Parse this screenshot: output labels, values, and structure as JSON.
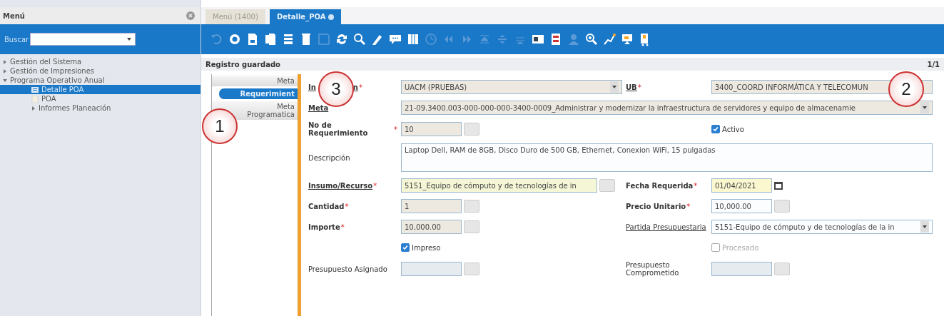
{
  "sidebar": {
    "title": "Menú",
    "search": {
      "label": "Buscar"
    },
    "tree": [
      {
        "label": "Gestión del Sistema",
        "expanded": false,
        "selected": false
      },
      {
        "label": "Gestión de Impresiones",
        "expanded": false,
        "selected": false
      },
      {
        "label": "Programa Operativo Anual",
        "expanded": true,
        "selected": false,
        "children": [
          {
            "label": "Detalle POA",
            "kind": "form",
            "selected": true
          },
          {
            "label": "POA",
            "kind": "doc",
            "selected": false
          },
          {
            "label": "Informes Planeación",
            "kind": "folder",
            "selected": false
          }
        ]
      }
    ]
  },
  "tabs": [
    {
      "label": "Menú (1400)",
      "selected": false,
      "closable": false
    },
    {
      "label": "Detalle_POA",
      "selected": true,
      "closable": true
    }
  ],
  "toolbar": [
    {
      "disabled": true
    },
    {
      "disabled": false
    },
    {
      "disabled": false
    },
    {
      "disabled": false
    },
    {
      "disabled": false
    },
    {
      "disabled": false
    },
    {
      "disabled": true
    },
    {
      "disabled": false
    },
    {
      "disabled": false
    },
    {
      "disabled": false
    },
    {
      "disabled": false
    },
    {
      "disabled": false
    },
    {
      "disabled": true
    },
    {
      "disabled": true
    },
    {
      "disabled": true
    },
    {
      "disabled": true
    },
    {
      "disabled": true
    },
    {
      "disabled": true
    },
    {
      "disabled": false
    },
    {
      "disabled": false
    },
    {
      "disabled": true
    },
    {
      "disabled": false
    },
    {
      "disabled": false
    },
    {
      "disabled": false
    },
    {
      "disabled": false
    }
  ],
  "status": {
    "message": "Registro guardado",
    "record": "1/1"
  },
  "side_tabs": [
    {
      "lines": [
        "Meta"
      ],
      "selected": false
    },
    {
      "lines": [
        "Requerimient"
      ],
      "selected": true
    },
    {
      "lines": [
        "Meta",
        "Programatica"
      ],
      "selected": false
    }
  ],
  "form": {
    "rows": [
      [
        {
          "kind": "select",
          "label": "In",
          "label_end": "n",
          "asterisk": "*",
          "link": true,
          "bold": true,
          "value": "UACM (PRUEBAS)",
          "color": "#ede9e0"
        },
        {
          "kind": "text",
          "label": "UB",
          "asterisk": "*",
          "link": true,
          "bold": true,
          "value": "3400_COORD INFORMÁTICA Y TELECOMUN",
          "color": "#ede9e0"
        }
      ],
      [
        {
          "kind": "select",
          "label": "Meta",
          "link": true,
          "bold": true,
          "value": "21-09.3400.003-000-000-000-3400-0009_Administrar y modernizar la infraestructura de servidores y equipo de almacenamie",
          "color": "#ede9e0",
          "wide": true
        }
      ],
      [
        {
          "kind": "lookup",
          "label": "No de Requerimiento",
          "asterisk": "*",
          "link": false,
          "bold": true,
          "value": "10",
          "color": "#ede9e0"
        },
        {
          "kind": "checkbox",
          "text": "Activo",
          "checked": true,
          "disabled": false
        }
      ],
      [
        {
          "kind": "textarea",
          "label": "Descripción",
          "link": false,
          "bold": false,
          "value": "Laptop Dell, RAM de 8GB, Disco Duro de 500 GB, Ethernet, Conexion WiFi, 15 pulgadas",
          "color": "#fbfdff",
          "wide": true
        }
      ],
      [
        {
          "kind": "lookup",
          "label": "Insumo/Recurso",
          "asterisk": "*",
          "link": true,
          "bold": true,
          "value": "5151_Equipo de cómputo y de tecnologías de in",
          "color": "#f4f6d6",
          "wide": false
        },
        {
          "kind": "date",
          "label": "Fecha Requerida",
          "asterisk": "*",
          "link": false,
          "bold": true,
          "value": "01/04/2021",
          "color": "#fbf8d0"
        }
      ],
      [
        {
          "kind": "lookup",
          "label": "Cantidad",
          "asterisk": "*",
          "link": false,
          "bold": true,
          "value": "1",
          "color": "#ede9e0"
        },
        {
          "kind": "lookup",
          "label": "Precio Unitario",
          "asterisk": "*",
          "link": false,
          "bold": true,
          "value": "10,000.00",
          "color": "#fbfdff"
        }
      ],
      [
        {
          "kind": "lookup",
          "label": "Importe",
          "asterisk": "*",
          "link": false,
          "bold": true,
          "value": "10,000.00",
          "color": "#ede9e0"
        },
        {
          "kind": "select",
          "label": "Partida Presupuestaria",
          "link": true,
          "bold": false,
          "value": "5151-Equipo de cómputo y de tecnologías de la in",
          "color": "#fbfdff"
        }
      ],
      [
        {
          "kind": "checkbox",
          "text": "Impreso",
          "checked": true,
          "disabled": false
        },
        {
          "kind": "checkbox",
          "text": "Procesado",
          "checked": false,
          "disabled": true
        }
      ],
      [
        {
          "kind": "lookup",
          "label": "Presupuesto Asignado",
          "link": false,
          "bold": false,
          "color": "#e6ebf0"
        },
        {
          "kind": "lookup",
          "label": "Presupuesto Comprometido",
          "link": false,
          "bold": false,
          "color": "#e6ebf0"
        }
      ]
    ]
  },
  "callouts": [
    {
      "number": "1"
    },
    {
      "number": "2"
    },
    {
      "number": "3"
    }
  ]
}
